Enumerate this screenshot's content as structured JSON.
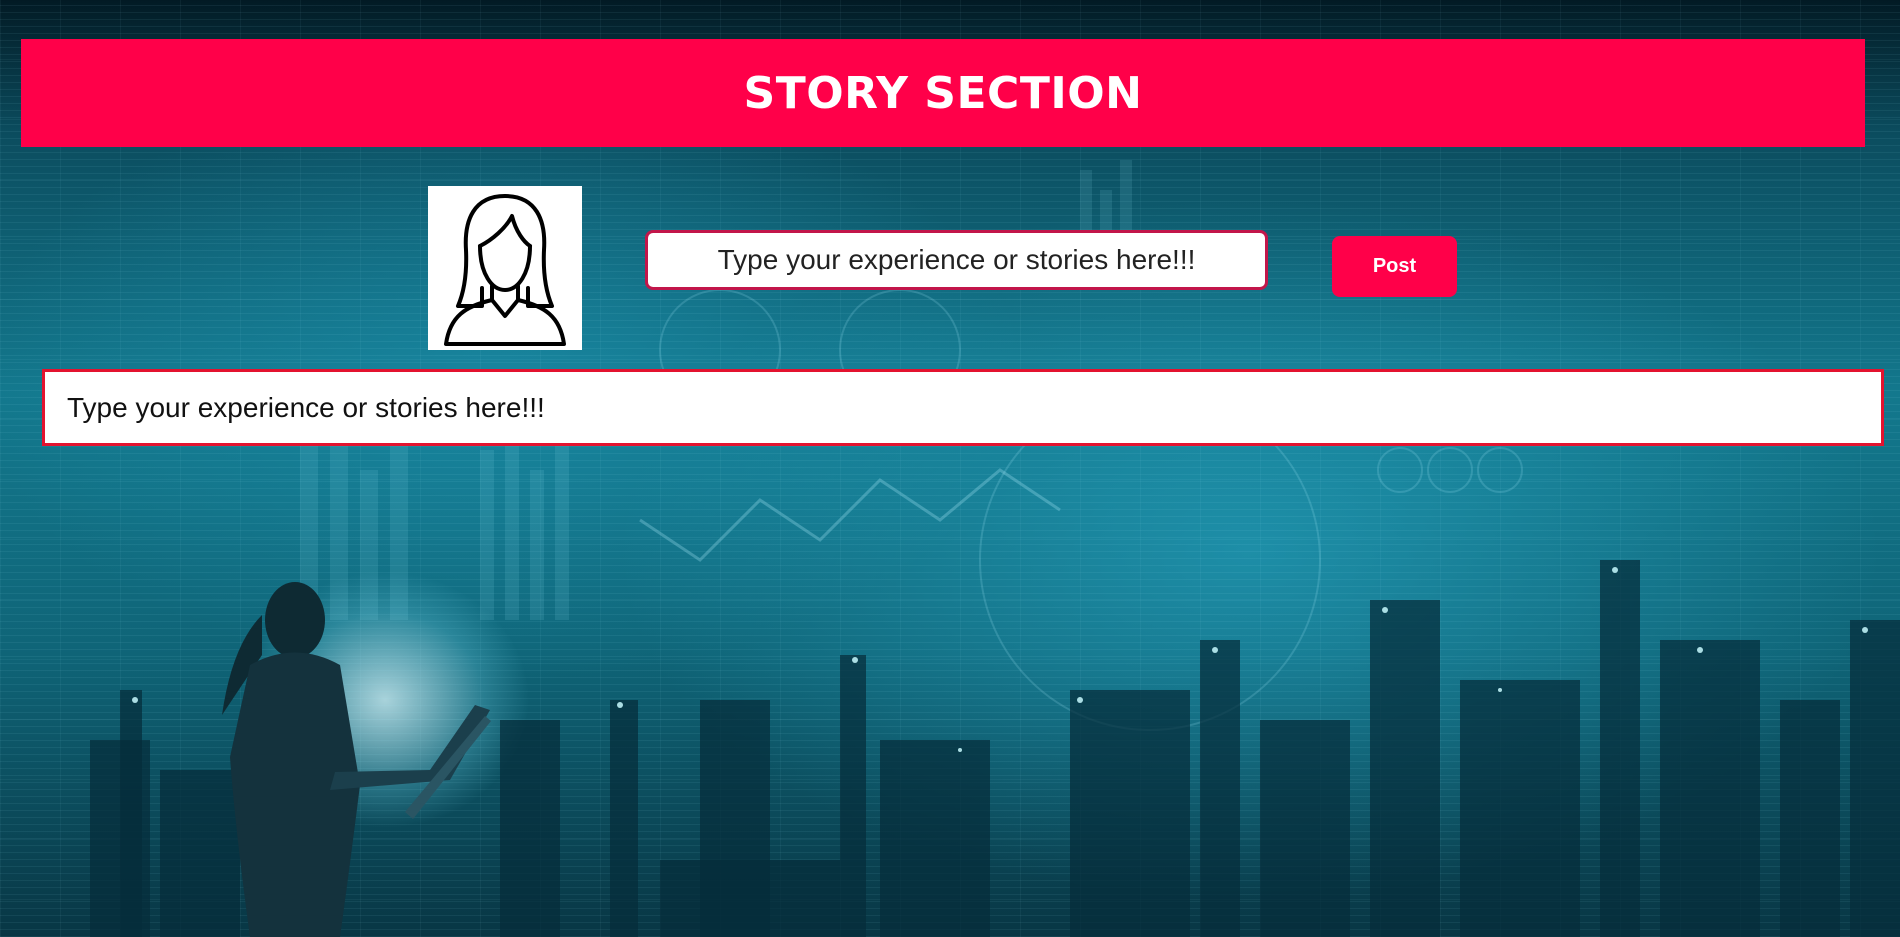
{
  "header": {
    "title": "STORY SECTION",
    "background_color": "#ff0049",
    "text_color": "#ffffff"
  },
  "avatar": {
    "icon": "woman-avatar-icon"
  },
  "story_form": {
    "input_placeholder": "Type your experience or stories here!!!",
    "input_value": "",
    "input_border_color": "#c2164a",
    "post_label": "Post",
    "post_color": "#ff0049"
  },
  "story_feed": {
    "entries": [
      {
        "text": "Type your experience or stories here!!!"
      }
    ],
    "border_color": "#e3132f"
  },
  "background": {
    "theme": "industrial-technology-teal",
    "primary_color": "#13788d"
  }
}
